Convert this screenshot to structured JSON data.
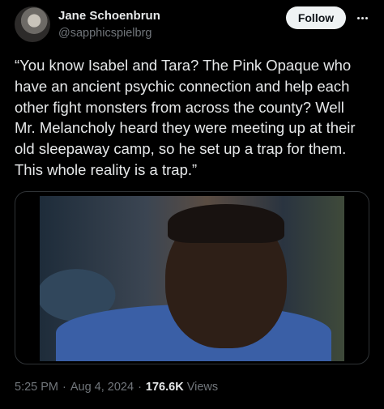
{
  "author": {
    "name": "Jane Schoenbrun",
    "handle": "@sapphicspielbrg"
  },
  "actions": {
    "follow_label": "Follow"
  },
  "tweet": {
    "text": "“You know Isabel and Tara? The Pink Opaque who\nhave an ancient psychic connection and help each\nother fight monsters from across the county? Well\nMr. Melancholy heard they were meeting up at their\nold sleepaway camp, so he set up a trap for them.\nThis whole reality is a trap.”"
  },
  "meta": {
    "time": "5:25 PM",
    "date": "Aug 4, 2024",
    "views_count": "176.6K",
    "views_label": "Views",
    "separator": "·"
  },
  "icons": {
    "more": "more-horizontal-icon"
  },
  "colors": {
    "background": "#000000",
    "text": "#e7e9ea",
    "secondary_text": "#71767b",
    "button_bg": "#eff3f4",
    "border": "#2f3336"
  }
}
